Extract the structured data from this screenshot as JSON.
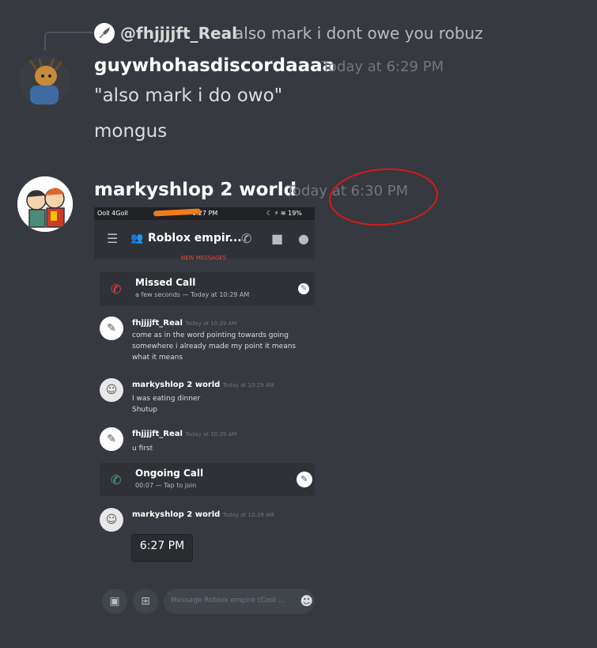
{
  "reply": {
    "username": "@fhjjjjft_Real",
    "text": "also mark i dont owe you robuz"
  },
  "message1": {
    "username": "guywhohasdiscordaaaa",
    "timestamp": "Today at 6:29 PM",
    "lines": [
      "\"also mark i do owo\"",
      "mongus"
    ]
  },
  "message2": {
    "username": "markyshlop 2 world",
    "timestamp_part1": "Today",
    "timestamp_part2": " at 6:30 PM"
  },
  "screenshot": {
    "status_left": "Ooll 4Goll",
    "status_time": "6:27 PM",
    "status_right": "☾ ⚡ ≋ 19%",
    "channel_title": "Roblox empir...",
    "new_messages": "NEW MESSAGES",
    "missed_call": {
      "title": "Missed Call",
      "subtitle": "a few seconds — Today at 10:29 AM"
    },
    "messages": [
      {
        "author": "fhjjjjft_Real",
        "time": "Today at 10:29 AM",
        "lines": [
          "come as in the word pointing towards going",
          "somewhere i already made my point it means",
          "what it means"
        ]
      },
      {
        "author": "markyshlop 2 world",
        "time": "Today at 10:29 AM",
        "lines": [
          "I was eating dinner",
          "Shutup"
        ]
      },
      {
        "author": "fhjjjjft_Real",
        "time": "Today at 10:29 AM",
        "lines": [
          "u first"
        ]
      }
    ],
    "ongoing_call": {
      "title": "Ongoing Call",
      "subtitle": "00:07 — Tap to join"
    },
    "last_author": "markyshlop 2 world",
    "last_time": "Today at 10:29 AM",
    "time_box": "6:27 PM",
    "input_placeholder": "Message Roblox empire (Cool ..."
  },
  "colors": {
    "background": "#36393f",
    "annotation_circle": "#d81a1a",
    "missed_call_icon": "#f04747",
    "ongoing_call_icon": "#43b581",
    "scribble": "#f07b1a"
  },
  "icons": {
    "avatar1": "user-avatar-character",
    "avatar2": "user-avatar-cartoon",
    "phone_missed": "phone-missed-icon",
    "phone_ongoing": "phone-call-icon"
  }
}
